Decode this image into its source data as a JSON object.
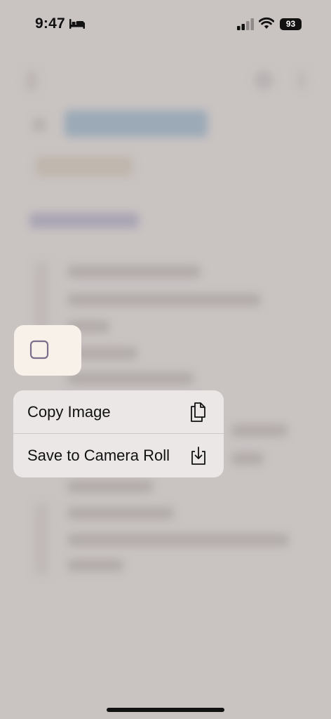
{
  "status_bar": {
    "time": "9:47",
    "battery": "93",
    "icons": [
      "sleep-icon",
      "signal-icon",
      "wifi-icon"
    ]
  },
  "preview": {
    "icon": "checkbox-icon"
  },
  "context_menu": {
    "items": [
      {
        "label": "Copy Image",
        "icon": "copy-icon"
      },
      {
        "label": "Save to Camera Roll",
        "icon": "save-download-icon"
      }
    ]
  },
  "colors": {
    "background": "#c9c3c2",
    "menu_background": "#ebe7e6",
    "preview_background": "#f8f1ea",
    "checkbox_outline": "#7a6e8a",
    "blurred_title": "#5b86a8",
    "blurred_heading": "#6d6a9a"
  }
}
